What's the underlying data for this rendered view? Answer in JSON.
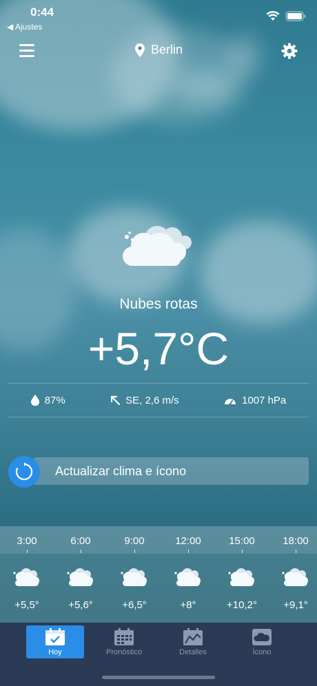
{
  "status_bar": {
    "time": "0:44",
    "back_label": "◀ Ajustes"
  },
  "header": {
    "location": "Berlin",
    "icons": [
      "menu-icon",
      "location-pin-icon",
      "gear-icon"
    ]
  },
  "current": {
    "description": "Nubes rotas",
    "temperature": "+5,7°C",
    "humidity": "87%",
    "wind": "SE, 2,6 m/s",
    "pressure": "1007 hPa",
    "icon": "broken-clouds-icon"
  },
  "update_button": {
    "label": "Actualizar clima e ícono"
  },
  "forecast": [
    {
      "time": "3:00",
      "temp": "+5,5°"
    },
    {
      "time": "6:00",
      "temp": "+5,6°"
    },
    {
      "time": "9:00",
      "temp": "+6,5°"
    },
    {
      "time": "12:00",
      "temp": "+8°"
    },
    {
      "time": "15:00",
      "temp": "+10,2°"
    },
    {
      "time": "18:00",
      "temp": "+9,1°"
    }
  ],
  "tabs": [
    {
      "label": "Hoy",
      "icon": "calendar-check-icon",
      "active": true
    },
    {
      "label": "Pronóstico",
      "icon": "calendar-grid-icon",
      "active": false
    },
    {
      "label": "Detalles",
      "icon": "chart-icon",
      "active": false
    },
    {
      "label": "Ícono",
      "icon": "cloud-icon",
      "active": false
    }
  ],
  "colors": {
    "accent": "#2a8de8",
    "tabbar": "#2b3a55",
    "inactive_tab": "#8d9ab0"
  }
}
